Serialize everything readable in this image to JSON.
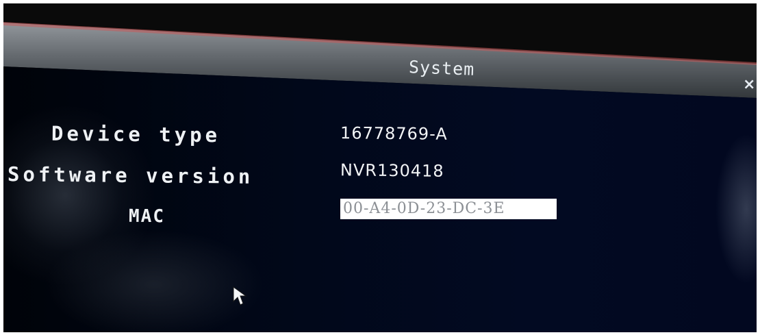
{
  "window": {
    "title": "System",
    "close_symbol": "×"
  },
  "fields": {
    "device_type": {
      "label": "Device type",
      "value": "16778769-A"
    },
    "software_version": {
      "label": "Software version",
      "value": "NVR130418"
    },
    "mac": {
      "label": "MAC",
      "value": "00-A4-0D-23-DC-3E"
    }
  },
  "colors": {
    "panel_background": "#020a22",
    "title_bar": "#6d7277",
    "text": "#eef1f4",
    "field_background": "#ffffff",
    "field_text": "#8b8f94"
  },
  "icons": {
    "close": "close-icon",
    "pointer": "mouse-pointer-icon"
  }
}
